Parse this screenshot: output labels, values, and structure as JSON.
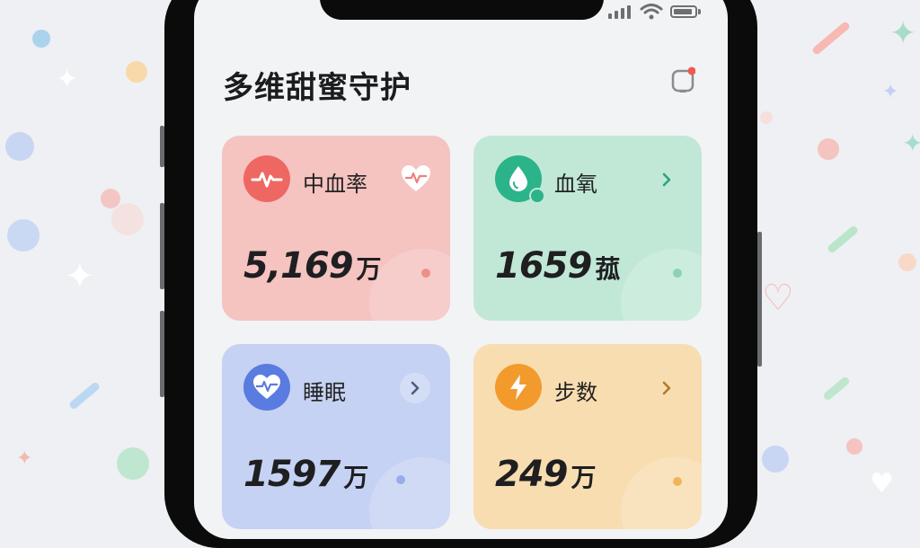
{
  "app": {
    "title": "多维甜蜜守护"
  },
  "colors": {
    "background": "#eef0f3",
    "screen": "#f2f3f5",
    "heart_card": "#f5c3c0",
    "oxygen_card": "#c1e8d7",
    "sleep_card": "#c6d2f3",
    "steps_card": "#f8ddb0"
  },
  "cards": [
    {
      "label": "中血率",
      "value": "5,169",
      "unit": "万",
      "icon": "heartbeat-icon",
      "action_icon": "heart-outline-icon"
    },
    {
      "label": "血氧",
      "value": "1659",
      "unit": "菰",
      "icon": "water-drop-icon",
      "action_icon": "chevron-right-icon"
    },
    {
      "label": "睡眠",
      "value": "1597",
      "unit": "万",
      "icon": "heart-pulse-icon",
      "action_icon": "chevron-right-icon"
    },
    {
      "label": "步数",
      "value": "249",
      "unit": "万",
      "icon": "lightning-icon",
      "action_icon": "chevron-right-icon"
    }
  ]
}
